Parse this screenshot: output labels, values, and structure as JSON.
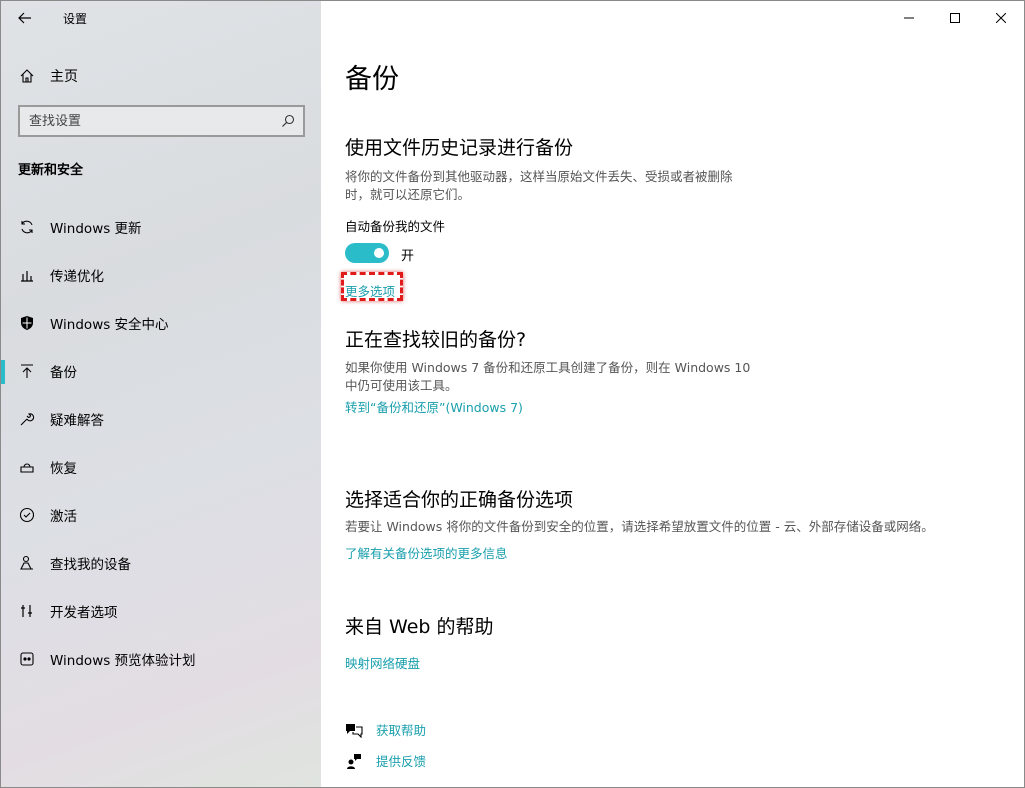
{
  "window": {
    "title": "设置"
  },
  "sidebar": {
    "home_label": "主页",
    "search_placeholder": "查找设置",
    "section_title": "更新和安全",
    "items": [
      {
        "label": "Windows 更新",
        "icon": "refresh-icon"
      },
      {
        "label": "传递优化",
        "icon": "delivery-icon"
      },
      {
        "label": "Windows 安全中心",
        "icon": "shield-icon"
      },
      {
        "label": "备份",
        "icon": "backup-icon",
        "active": true
      },
      {
        "label": "疑难解答",
        "icon": "wrench-icon"
      },
      {
        "label": "恢复",
        "icon": "recovery-icon"
      },
      {
        "label": "激活",
        "icon": "check-circle-icon"
      },
      {
        "label": "查找我的设备",
        "icon": "find-device-icon"
      },
      {
        "label": "开发者选项",
        "icon": "developer-icon"
      },
      {
        "label": "Windows 预览体验计划",
        "icon": "insider-icon"
      }
    ]
  },
  "main": {
    "title": "备份",
    "file_history": {
      "heading": "使用文件历史记录进行备份",
      "desc_line1": "将你的文件备份到其他驱动器，这样当原始文件丢失、受损或者被删除",
      "desc_line2": "时，就可以还原它们。",
      "toggle_label": "自动备份我的文件",
      "toggle_state": "开",
      "more_options": "更多选项"
    },
    "older_backup": {
      "heading": "正在查找较旧的备份?",
      "desc_line1": "如果你使用 Windows 7 备份和还原工具创建了备份，则在 Windows 10",
      "desc_line2": "中仍可使用该工具。",
      "link": "转到“备份和还原”(Windows 7)"
    },
    "right_option": {
      "heading": "选择适合你的正确备份选项",
      "desc": "若要让 Windows 将你的文件备份到安全的位置，请选择希望放置文件的位置 - 云、外部存储设备或网络。",
      "link": "了解有关备份选项的更多信息"
    },
    "web_help": {
      "heading": "来自 Web 的帮助",
      "link": "映射网络硬盘"
    },
    "get_help": "获取帮助",
    "feedback": "提供反馈"
  },
  "colors": {
    "accent": "#2bbcc9",
    "link": "#1a9fad",
    "highlight": "#e01b1b"
  }
}
